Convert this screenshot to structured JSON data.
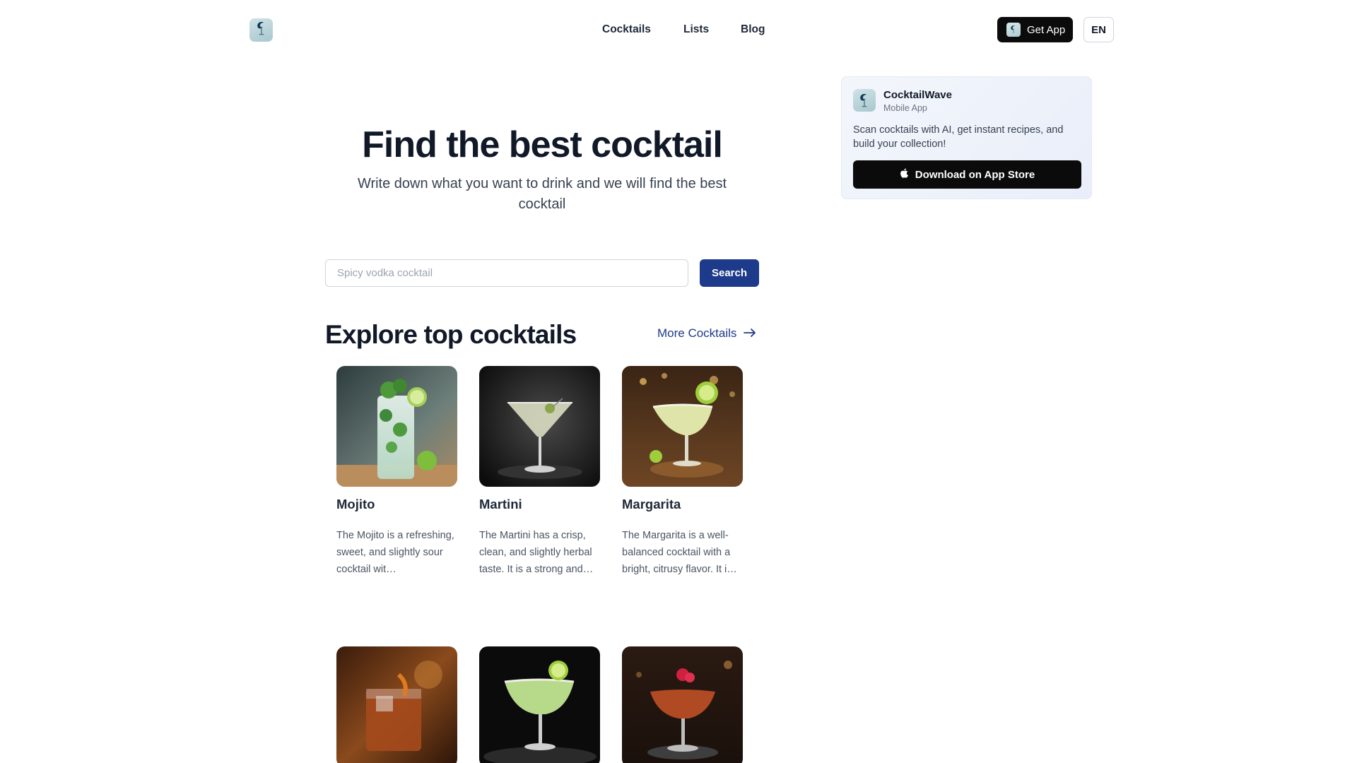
{
  "nav": {
    "logo_icon": "cocktail-logo-icon",
    "links": [
      "Cocktails",
      "Lists",
      "Blog"
    ],
    "get_app_label": "Get App",
    "language": "EN"
  },
  "promo": {
    "app_name": "CocktailWave",
    "app_type": "Mobile App",
    "description": "Scan cocktails with AI, get instant recipes, and build your collection!",
    "button_label": "Download on App Store",
    "button_icon": "apple-icon"
  },
  "hero": {
    "title": "Find the best cocktail",
    "subtitle": "Write down what you want to drink and we will find the best cocktail"
  },
  "search": {
    "placeholder": "Spicy vodka cocktail",
    "value": "",
    "button_label": "Search"
  },
  "section": {
    "title": "Explore top cocktails",
    "more_label": "More Cocktails"
  },
  "cocktails": [
    {
      "name": "Mojito",
      "description": "The Mojito is a refreshing, sweet, and slightly sour cocktail wit…"
    },
    {
      "name": "Martini",
      "description": "The Martini has a crisp, clean, and slightly herbal taste. It is a strong and…"
    },
    {
      "name": "Margarita",
      "description": "The Margarita is a well-balanced cocktail with a bright, citrusy flavor. It i…"
    },
    {
      "name": "",
      "description": ""
    },
    {
      "name": "",
      "description": ""
    },
    {
      "name": "",
      "description": ""
    }
  ],
  "colors": {
    "accent": "#1e3a8a",
    "dark_button": "#0b0b0b",
    "promo_bg": "#eef2fa"
  }
}
